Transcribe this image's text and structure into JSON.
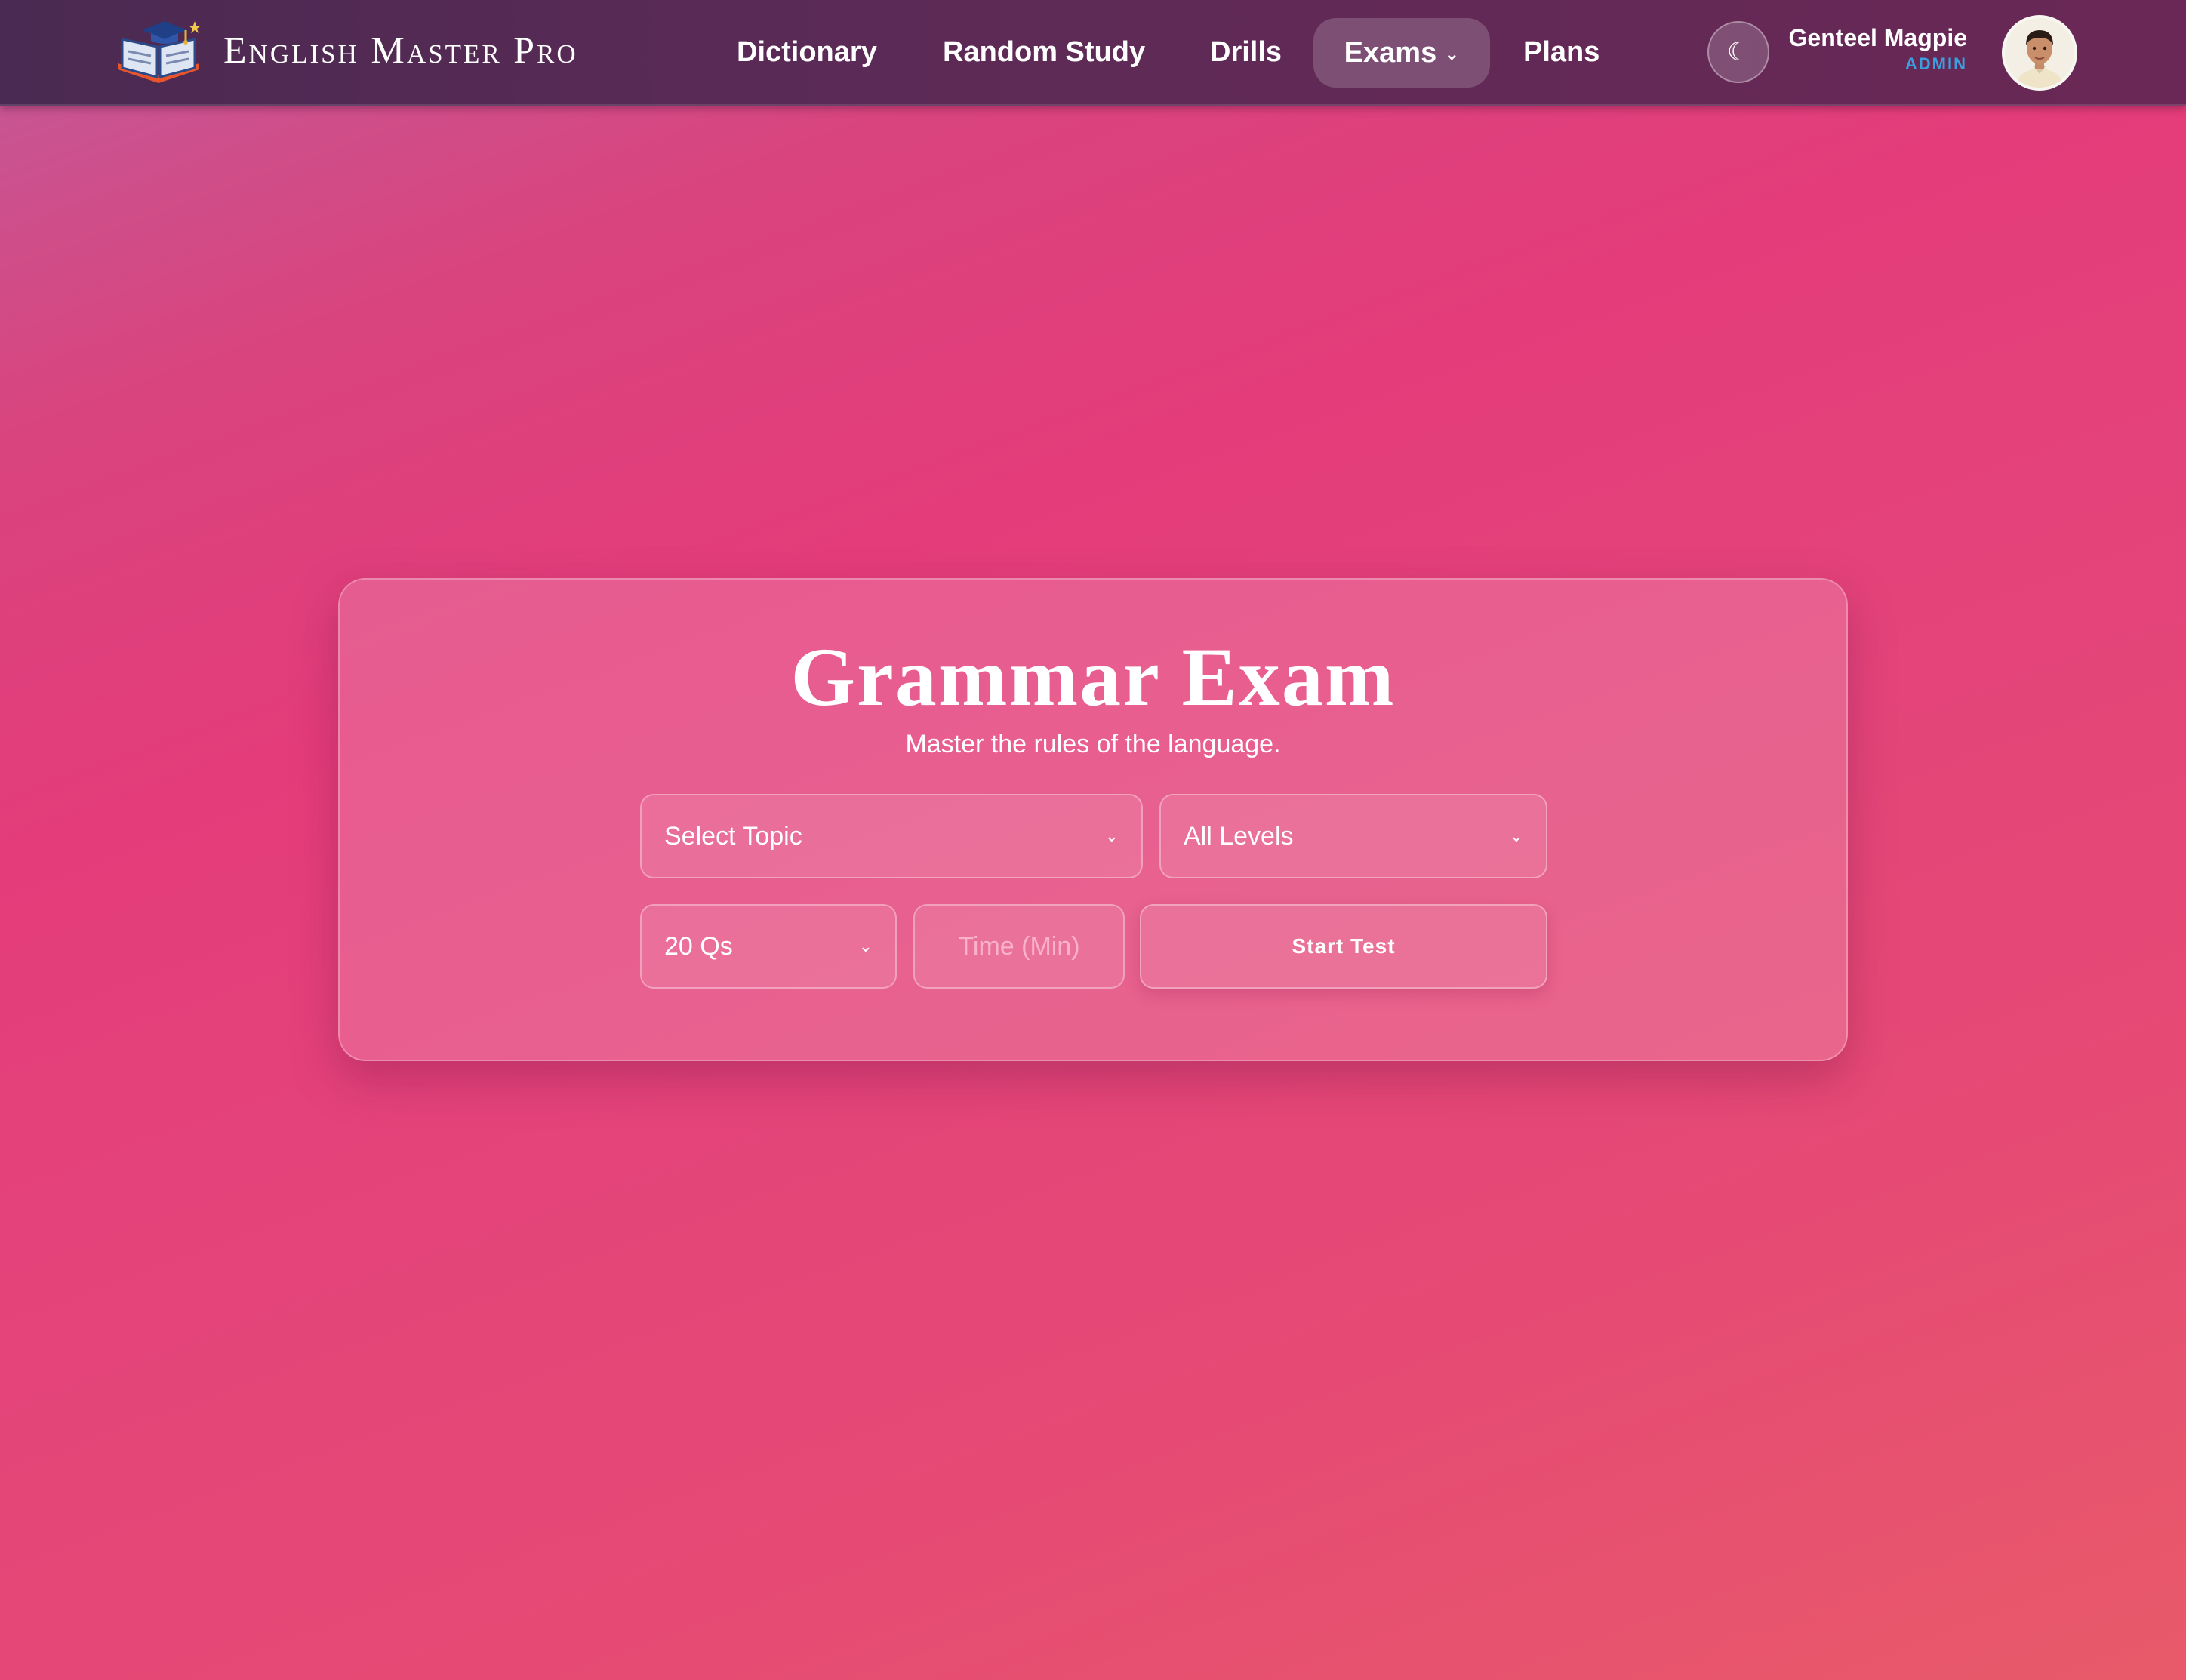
{
  "header": {
    "brand": "English Master Pro",
    "logo_icon": "book-graduation-cap-icon",
    "nav": {
      "dictionary": "Dictionary",
      "random_study": "Random Study",
      "drills": "Drills",
      "exams": "Exams",
      "plans": "Plans"
    },
    "theme_toggle_glyph": "☾",
    "user": {
      "name": "Genteel Magpie",
      "role": "ADMIN"
    }
  },
  "exam": {
    "title": "Grammar Exam",
    "subtitle": "Master the rules of the language.",
    "topic_select": "Select Topic",
    "level_select": "All Levels",
    "question_count_select": "20 Qs",
    "time_placeholder": "Time (Min)",
    "start_label": "Start Test"
  },
  "colors": {
    "nav_bg": "#5c2a56",
    "role_accent": "#3aa0e0",
    "page_gradient_start": "#c25a98",
    "page_gradient_end": "#e85a6a"
  }
}
